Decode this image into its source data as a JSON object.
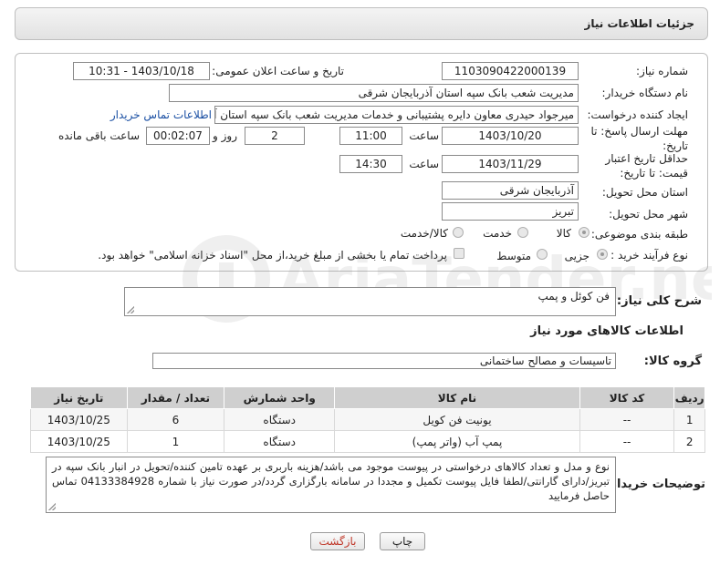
{
  "header": {
    "title": "جزئیات اطلاعات نیاز"
  },
  "form": {
    "need_number_label": "شماره نیاز:",
    "need_number": "1103090422000139",
    "announce_label": "تاریخ و ساعت اعلان عمومی:",
    "announce_value": "1403/10/18 - 10:31",
    "buyer_org_label": "نام دستگاه خریدار:",
    "buyer_org": "مدیریت شعب بانک سپه استان آذربایجان شرقی",
    "creator_label": "ایجاد کننده درخواست:",
    "creator": "میرجواد حیدری معاون دایره پشتیبانی و خدمات مدیریت شعب بانک سپه استان آ",
    "buyer_contact_link": "اطلاعات تماس خریدار",
    "reply_deadline_label": "مهلت ارسال پاسخ: تا تاریخ:",
    "reply_date": "1403/10/20",
    "time_label": "ساعت",
    "reply_time": "11:00",
    "days_value": "2",
    "days_label": "روز و",
    "remaining_time": "00:02:07",
    "remaining_label": "ساعت باقی مانده",
    "price_validity_label": "حداقل تاریخ اعتبار قیمت: تا تاریخ:",
    "price_date": "1403/11/29",
    "price_time": "14:30",
    "province_label": "استان محل تحویل:",
    "province": "آذربایجان شرقی",
    "city_label": "شهر محل تحویل:",
    "city": "تبریز",
    "category_label": "طبقه بندی موضوعی:",
    "category_options": [
      "کالا",
      "خدمت",
      "کالا/خدمت"
    ],
    "purchase_type_label": "نوع فرآیند خرید :",
    "purchase_options": [
      "جزیی",
      "متوسط"
    ],
    "payment_note": "پرداخت تمام یا بخشی از مبلغ خرید،از محل \"اسناد خزانه اسلامی\" خواهد بود."
  },
  "summary": {
    "label": "شرح کلی نیاز:",
    "value": "فن کوئل و پمپ"
  },
  "goods_section": {
    "title": "اطلاعات کالاهای مورد نیاز"
  },
  "goods_group": {
    "label": "گروه کالا:",
    "value": "تاسیسات و مصالح ساختمانی"
  },
  "table": {
    "headers": [
      "ردیف",
      "کد کالا",
      "نام کالا",
      "واحد شمارش",
      "تعداد / مقدار",
      "تاریخ نیاز"
    ],
    "rows": [
      [
        "1",
        "--",
        "یونیت فن کویل",
        "دستگاه",
        "6",
        "1403/10/25"
      ],
      [
        "2",
        "--",
        "پمپ آب (واتر پمپ)",
        "دستگاه",
        "1",
        "1403/10/25"
      ]
    ]
  },
  "buyer_notes": {
    "label": "توضیحات خریدار:",
    "value": "نوع و مدل و تعداد کالاهای درخواستی در پیوست موجود می باشد/هزینه باربری بر عهده تامین کننده/تحویل در انبار بانک سپه در تبریز/دارای گارانتی/لطفا فایل پیوست تکمیل و مجددا در سامانه بارگزاری گردد/در صورت نیاز با شماره 04133384928 تماس حاصل فرمایید"
  },
  "buttons": {
    "print": "چاپ",
    "back": "بازگشت"
  },
  "watermark": {
    "brand": "AriaTender.net"
  },
  "colors": {
    "link": "#1a4fa3",
    "header_bg": "#e6e6e6",
    "table_header": "#cfcfcf"
  }
}
